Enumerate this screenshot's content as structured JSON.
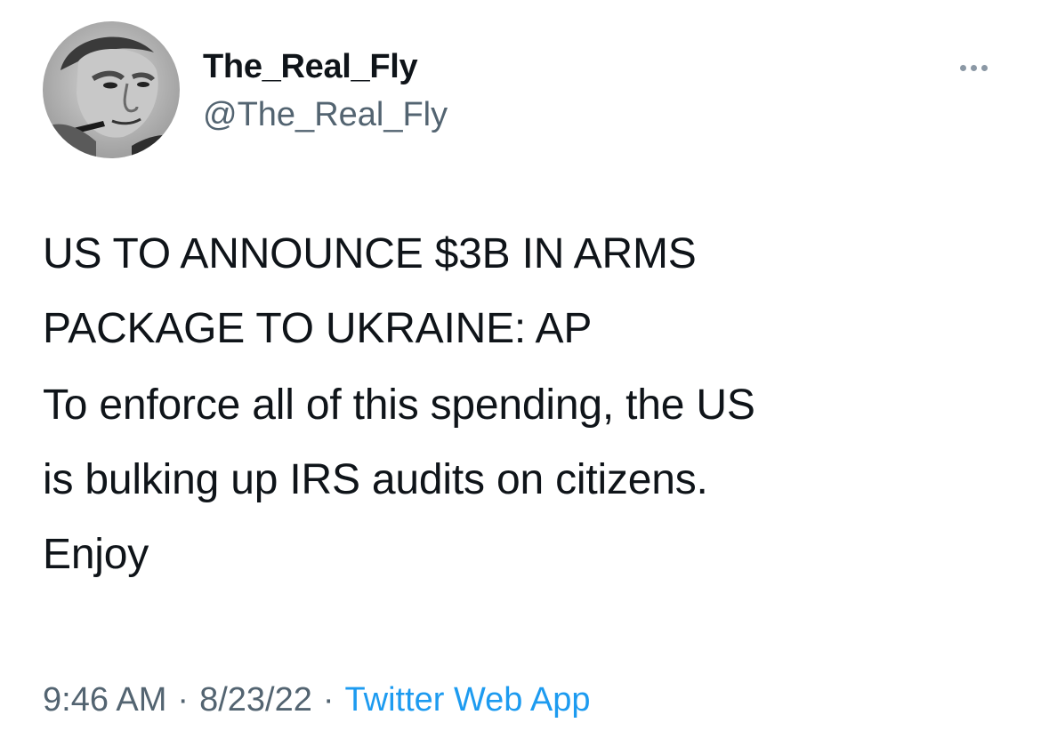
{
  "author": {
    "display_name": "The_Real_Fly",
    "handle": "@The_Real_Fly",
    "avatar_icon": "profile-photo-avatar"
  },
  "more_icon": "more-options-icon",
  "tweet": {
    "headline_lines": [
      "US TO ANNOUNCE $3B IN ARMS",
      "PACKAGE TO UKRAINE: AP"
    ],
    "comment_lines": [
      "To enforce all of this spending, the US",
      "is bulking up IRS audits on citizens.",
      "Enjoy"
    ]
  },
  "meta": {
    "time": "9:46 AM",
    "separator": "·",
    "date": "8/23/22",
    "source": "Twitter Web App"
  },
  "colors": {
    "text": "#0f1419",
    "secondary": "#536471",
    "link": "#1d9bf0",
    "background": "#ffffff"
  }
}
